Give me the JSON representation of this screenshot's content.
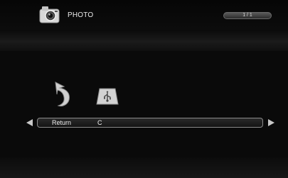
{
  "header": {
    "title": "PHOTO",
    "page_indicator": "1 / 1",
    "icon": "camera-icon"
  },
  "items": [
    {
      "label": "Return",
      "icon": "return-arrow-icon"
    },
    {
      "label": "C",
      "icon": "usb-drive-icon"
    }
  ],
  "selection": {
    "name": "Return",
    "value": "C"
  },
  "navigation": {
    "left": "arrow-left-icon",
    "right": "arrow-right-icon"
  },
  "colors": {
    "background": "#070707",
    "text": "#f0f0f0",
    "accent": "#8a8a8a"
  }
}
